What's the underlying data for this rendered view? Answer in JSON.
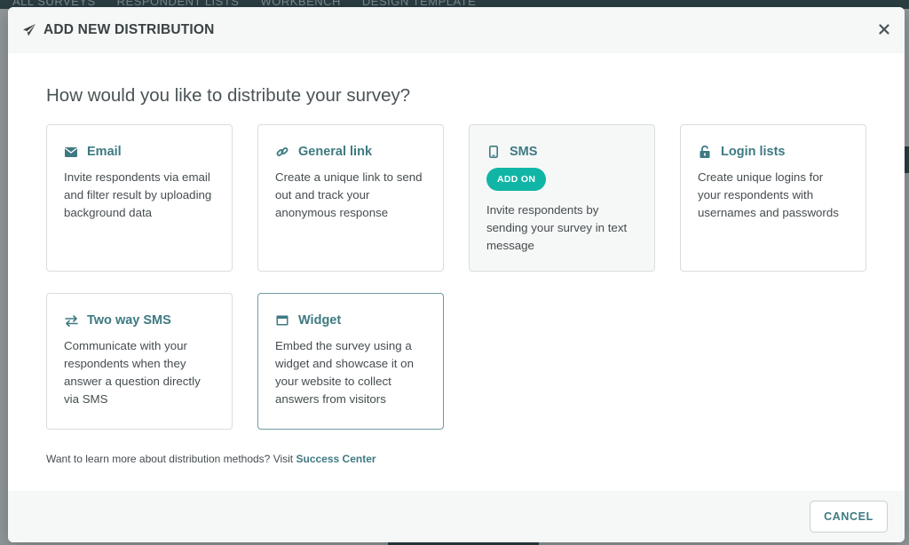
{
  "background": {
    "nav_items": [
      "ALL SURVEYS",
      "RESPONDENT LISTS",
      "WORKBENCH",
      "DESIGN TEMPLATE"
    ]
  },
  "modal": {
    "title": "ADD NEW DISTRIBUTION",
    "title_icon": "paper-plane-icon",
    "close_icon": "close-icon",
    "question": "How would you like to distribute your survey?",
    "cards": [
      {
        "id": "email",
        "title": "Email",
        "icon": "envelope-icon",
        "description": "Invite respondents via email and filter result by uploading background data"
      },
      {
        "id": "general-link",
        "title": "General link",
        "icon": "link-icon",
        "description": "Create a unique link to send out and track your anonymous response"
      },
      {
        "id": "sms",
        "title": "SMS",
        "icon": "mobile-phone-icon",
        "badge": "ADD ON",
        "description": "Invite respondents by sending your survey in text message"
      },
      {
        "id": "login-lists",
        "title": "Login lists",
        "icon": "unlock-icon",
        "description": "Create unique logins for your respondents with usernames and passwords"
      },
      {
        "id": "two-way-sms",
        "title": "Two way SMS",
        "icon": "exchange-arrows-icon",
        "description": "Communicate with your respondents when they answer a question directly via SMS"
      },
      {
        "id": "widget",
        "title": "Widget",
        "icon": "window-icon",
        "description": "Embed the survey using a widget and showcase it on your website to collect answers from visitors"
      }
    ],
    "learn_more_text": "Want to learn more about distribution methods? Visit",
    "learn_more_link": "Success Center",
    "cancel_label": "CANCEL"
  },
  "colors": {
    "accent": "#3e7a82",
    "badge": "#11b5a6",
    "header_bg": "#f6f7f7"
  }
}
